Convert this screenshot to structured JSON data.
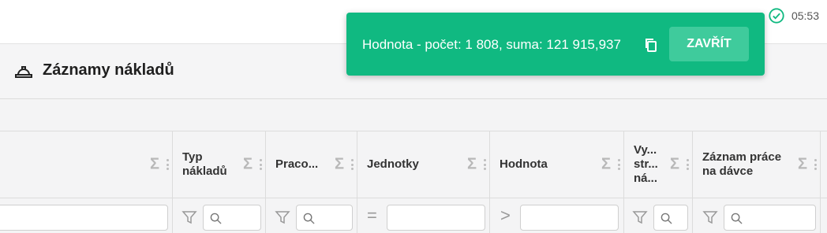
{
  "status": {
    "time": "05:53",
    "icon": "check-circle-icon"
  },
  "page": {
    "title": "Záznamy nákladů",
    "title_icon": "hard-hat-icon"
  },
  "grid": {
    "columns": [
      {
        "label": "",
        "sigma": "Σ"
      },
      {
        "label": "Typ\nnákladů",
        "sigma": "Σ"
      },
      {
        "label": "Praco...",
        "sigma": "Σ"
      },
      {
        "label": "Jednotky",
        "sigma": "Σ"
      },
      {
        "label": "Hodnota",
        "sigma": "Σ"
      },
      {
        "label": "Vy...\nstr...\nná...",
        "sigma": "Σ"
      },
      {
        "label": "Záznam práce\nna dávce",
        "sigma": "Σ"
      }
    ],
    "filters": {
      "equals": "=",
      "greater": ">"
    }
  },
  "toast": {
    "message": "Hodnota - počet: 1 808, suma: 121 915,937",
    "close_label": "ZAVŘÍT",
    "bg_color": "#10b981"
  }
}
